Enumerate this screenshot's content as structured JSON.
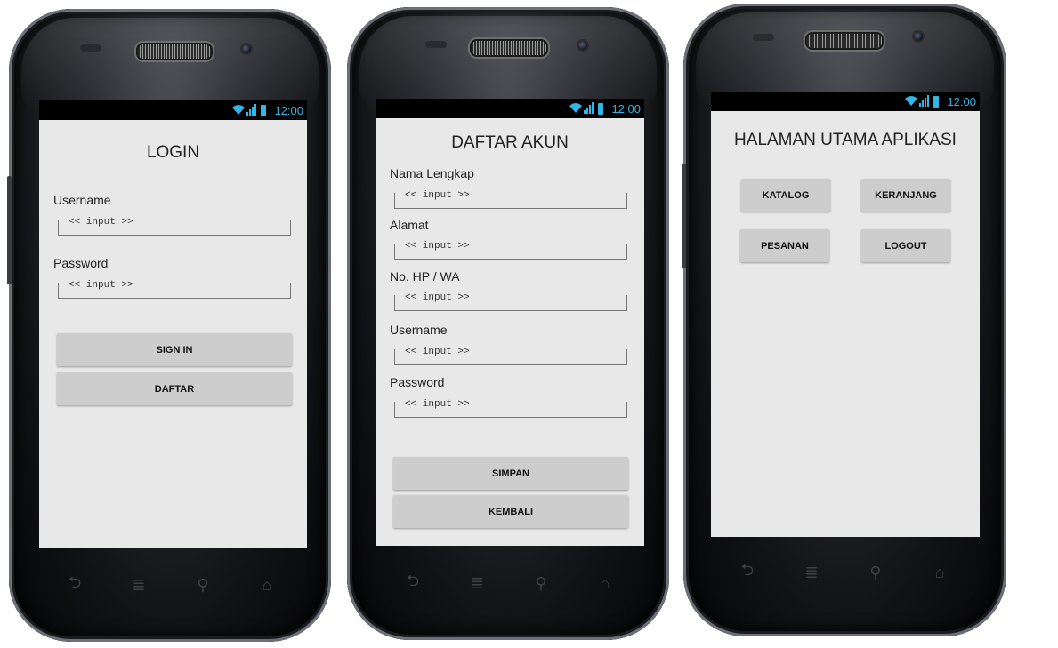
{
  "status_bar": {
    "time": "12:00"
  },
  "login": {
    "title": "LOGIN",
    "username_label": "Username",
    "username_placeholder": "<< input >>",
    "password_label": "Password",
    "password_placeholder": "<< input >>",
    "signin_button": "SIGN IN",
    "register_button": "DAFTAR"
  },
  "register": {
    "title": "DAFTAR AKUN",
    "fields": [
      {
        "label": "Nama Lengkap",
        "placeholder": "<< input >>"
      },
      {
        "label": "Alamat",
        "placeholder": "<< input >>"
      },
      {
        "label": "No. HP / WA",
        "placeholder": "<< input >>"
      },
      {
        "label": "Username",
        "placeholder": "<< input >>"
      },
      {
        "label": "Password",
        "placeholder": "<< input >>"
      }
    ],
    "save_button": "SIMPAN",
    "back_button": "KEMBALI"
  },
  "home": {
    "title": "HALAMAN UTAMA APLIKASI",
    "buttons": {
      "katalog": "KATALOG",
      "keranjang": "KERANJANG",
      "pesanan": "PESANAN",
      "logout": "LOGOUT"
    }
  },
  "colors": {
    "accent": "#33b5e5",
    "screen_bg": "#e8e8e8",
    "button_bg": "#cdcdcd"
  },
  "nav_icons": [
    "back-icon",
    "recent-apps-icon",
    "search-icon",
    "home-icon"
  ]
}
